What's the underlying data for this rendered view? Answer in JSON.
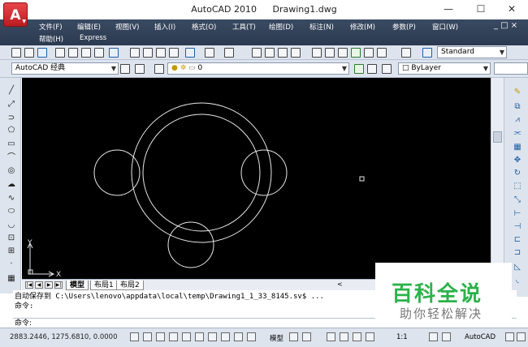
{
  "window": {
    "title_app": "AutoCAD 2010",
    "title_doc": "Drawing1.dwg",
    "logo_letter": "A",
    "minimize": "—",
    "maximize": "☐",
    "close": "✕"
  },
  "menu": {
    "row1": [
      "文件(F)",
      "编辑(E)",
      "视图(V)",
      "插入(I)",
      "格式(O)",
      "工具(T)",
      "绘图(D)",
      "标注(N)",
      "修改(M)",
      "参数(P)",
      "窗口(W)"
    ],
    "row2": [
      "帮助(H)",
      "Express"
    ],
    "mdi_controls": "_ □ ×"
  },
  "toolbar": {
    "text_style": "Standard",
    "workspace": "AutoCAD 经典",
    "layer": "0",
    "color": "ByLayer"
  },
  "drawing": {
    "ucs_x": "X",
    "ucs_y": "Y"
  },
  "tabs": {
    "model": "模型",
    "layout1": "布局1",
    "layout2": "布局2"
  },
  "command": {
    "line1": "自动保存到 C:\\Users\\lenovo\\appdata\\local\\temp\\Drawing1_1_33_8145.sv$ ...",
    "line2": "命令:",
    "prompt": "命令:"
  },
  "status": {
    "coordinates": "2883.2446, 1275.6810, 0.0000",
    "model_label": "模型",
    "scale": "1:1",
    "workspace": "AutoCAD"
  },
  "watermark": {
    "title": "百科全说",
    "subtitle": "助你轻松解决"
  }
}
